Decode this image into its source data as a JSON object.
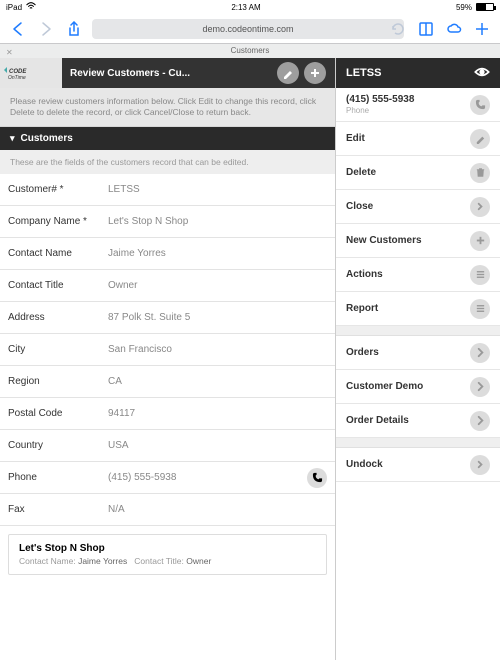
{
  "statusbar": {
    "device": "iPad",
    "time": "2:13 AM",
    "battery": "59%"
  },
  "browser": {
    "url": "demo.codeontime.com",
    "tab": "Customers"
  },
  "main": {
    "logo": "Code OnTime",
    "title": "Review Customers - Cu...",
    "note": "Please review customers information below. Click Edit to change this record, click Delete to delete the record, or click Cancel/Close to return back.",
    "section": "Customers",
    "sectionNote": "These are the fields of the customers record that can be edited.",
    "fields": [
      {
        "label": "Customer# *",
        "value": "LETSS"
      },
      {
        "label": "Company Name *",
        "value": "Let's Stop N Shop"
      },
      {
        "label": "Contact Name",
        "value": "Jaime Yorres"
      },
      {
        "label": "Contact Title",
        "value": "Owner"
      },
      {
        "label": "Address",
        "value": "87 Polk St. Suite 5"
      },
      {
        "label": "City",
        "value": "San Francisco"
      },
      {
        "label": "Region",
        "value": "CA"
      },
      {
        "label": "Postal Code",
        "value": "94117"
      },
      {
        "label": "Country",
        "value": "USA"
      },
      {
        "label": "Phone",
        "value": "(415) 555-5938",
        "phone": true
      },
      {
        "label": "Fax",
        "value": "N/A"
      }
    ],
    "card": {
      "title": "Let's Stop N Shop",
      "line2a": "Contact Name:",
      "line2b": "Jaime Yorres",
      "line2c": "Contact Title:",
      "line2d": "Owner"
    }
  },
  "side": {
    "title": "LETSS",
    "phone": "(415) 555-5938",
    "phoneLabel": "Phone",
    "items1": [
      {
        "key": "edit",
        "label": "Edit",
        "icon": "pencil"
      },
      {
        "key": "delete",
        "label": "Delete",
        "icon": "trash"
      },
      {
        "key": "close",
        "label": "Close",
        "icon": "arrow"
      },
      {
        "key": "new",
        "label": "New Customers",
        "icon": "plus"
      },
      {
        "key": "actions",
        "label": "Actions",
        "icon": "menu"
      },
      {
        "key": "report",
        "label": "Report",
        "icon": "menu"
      }
    ],
    "items2": [
      {
        "key": "orders",
        "label": "Orders",
        "icon": "chev"
      },
      {
        "key": "demo",
        "label": "Customer Demo",
        "icon": "chev"
      },
      {
        "key": "details",
        "label": "Order Details",
        "icon": "chev"
      }
    ],
    "items3": [
      {
        "key": "undock",
        "label": "Undock",
        "icon": "arrow"
      }
    ]
  }
}
